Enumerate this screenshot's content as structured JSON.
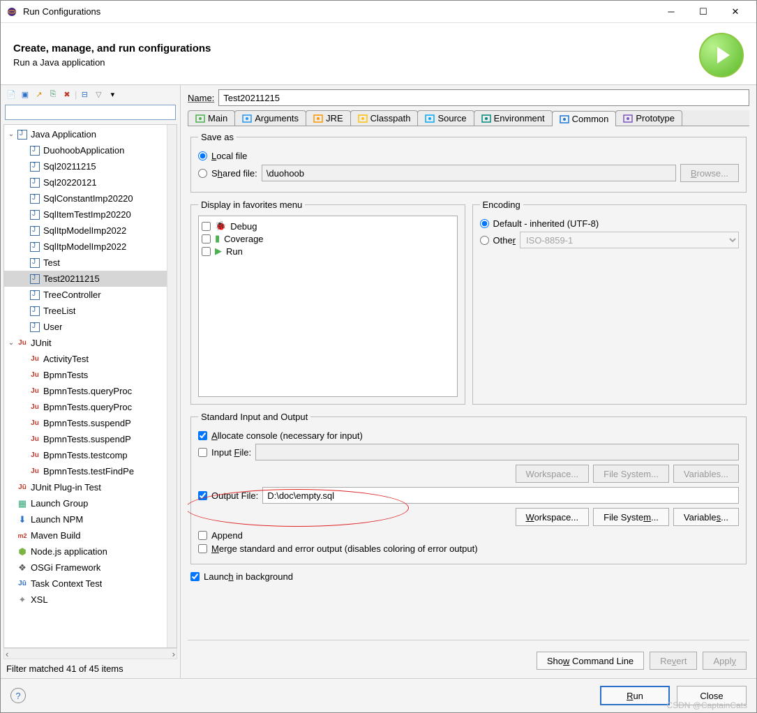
{
  "window": {
    "title": "Run Configurations"
  },
  "header": {
    "title": "Create, manage, and run configurations",
    "subtitle": "Run a Java application"
  },
  "filter": {
    "placeholder": "",
    "status": "Filter matched 41 of 45 items"
  },
  "tree": {
    "java_app": {
      "label": "Java Application",
      "items": [
        "DuohoobApplication",
        "Sql20211215",
        "Sql20220121",
        "SqlConstantImp20220",
        "SqlItemTestImp20220",
        "SqlItpModelImp2022",
        "SqlItpModelImp2022",
        "Test",
        "Test20211215",
        "TreeController",
        "TreeList",
        "User"
      ],
      "selected": "Test20211215"
    },
    "junit": {
      "label": "JUnit",
      "items": [
        "ActivityTest",
        "BpmnTests",
        "BpmnTests.queryProc",
        "BpmnTests.queryProc",
        "BpmnTests.suspendP",
        "BpmnTests.suspendP",
        "BpmnTests.testcomp",
        "BpmnTests.testFindPe"
      ]
    },
    "others": [
      {
        "label": "JUnit Plug-in Test",
        "icon": "junit-plugin"
      },
      {
        "label": "Launch Group",
        "icon": "launch-group"
      },
      {
        "label": "Launch NPM",
        "icon": "npm"
      },
      {
        "label": "Maven Build",
        "icon": "maven"
      },
      {
        "label": "Node.js application",
        "icon": "node"
      },
      {
        "label": "OSGi Framework",
        "icon": "osgi"
      },
      {
        "label": "Task Context Test",
        "icon": "task"
      },
      {
        "label": "XSL",
        "icon": "xsl"
      }
    ]
  },
  "config": {
    "name_label": "Name:",
    "name_value": "Test20211215",
    "tabs": [
      "Main",
      "Arguments",
      "JRE",
      "Classpath",
      "Source",
      "Environment",
      "Common",
      "Prototype"
    ],
    "active_tab": "Common",
    "save_as": {
      "legend": "Save as",
      "local": "Local file",
      "shared": "Shared file:",
      "shared_value": "\\duohoob",
      "browse": "Browse..."
    },
    "favorites": {
      "legend": "Display in favorites menu",
      "items": [
        "Debug",
        "Coverage",
        "Run"
      ]
    },
    "encoding": {
      "legend": "Encoding",
      "default": "Default - inherited (UTF-8)",
      "other": "Other",
      "other_value": "ISO-8859-1"
    },
    "io": {
      "legend": "Standard Input and Output",
      "allocate": "Allocate console (necessary for input)",
      "input_file": "Input File:",
      "output_file": "Output File:",
      "output_value": "D:\\doc\\empty.sql",
      "workspace": "Workspace...",
      "filesystem": "File System...",
      "variables": "Variables...",
      "append": "Append",
      "merge": "Merge standard and error output (disables coloring of error output)"
    },
    "launch_bg": "Launch in background",
    "show_cmd": "Show Command Line",
    "revert": "Revert",
    "apply": "Apply"
  },
  "footer": {
    "run": "Run",
    "close": "Close"
  },
  "watermark": "CSDN @CaptainCats"
}
